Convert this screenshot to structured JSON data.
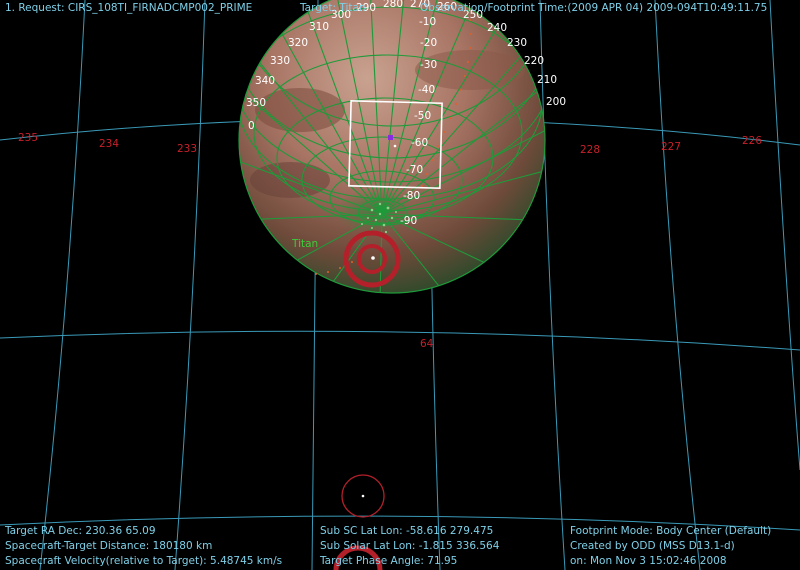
{
  "header": {
    "request": "1. Request: CIRS_108TI_FIRNADCMP002_PRIME",
    "target": "Target: Titan",
    "time": "Observation/Footprint Time:(2009 APR 04) 2009-094T10:49:11.75"
  },
  "sky_grid": {
    "ra_labels": [
      "235",
      "234",
      "233",
      "228",
      "227",
      "226"
    ],
    "dec_label": "64"
  },
  "globe": {
    "target_label": "Titan",
    "longitude_labels": [
      "0",
      "350",
      "340",
      "330",
      "320",
      "310",
      "300",
      "290",
      "280",
      "270",
      "260",
      "250",
      "240",
      "230",
      "220",
      "210",
      "200"
    ],
    "latitude_labels": [
      "-10",
      "-20",
      "-30",
      "-40",
      "-50",
      "-60",
      "-70",
      "-80",
      "-90"
    ]
  },
  "footer": {
    "left": [
      "Target RA Dec: 230.36  65.09",
      "Spacecraft-Target Distance:  180180 km",
      "Spacecraft Velocity(relative to Target): 5.48745 km/s"
    ],
    "middle": [
      "Sub SC Lat Lon: -58.616  279.475",
      "Sub Solar Lat Lon: -1.815  336.564",
      "Target Phase Angle: 71.95"
    ],
    "right": [
      "Footprint Mode: Body Center (Default)",
      "Created by ODD (MSS D13.1-d)",
      "on: Mon Nov  3 15:02:46 2008"
    ]
  },
  "colors": {
    "text": "#7fd0e8",
    "grid": "#3a9ab8",
    "ra_label": "#c8202a",
    "globe_grid": "#1f9a3a",
    "footprint": "#ffffff",
    "marker": "#b3202a",
    "track": "#e0602a",
    "target_label": "#3ccc3c"
  }
}
